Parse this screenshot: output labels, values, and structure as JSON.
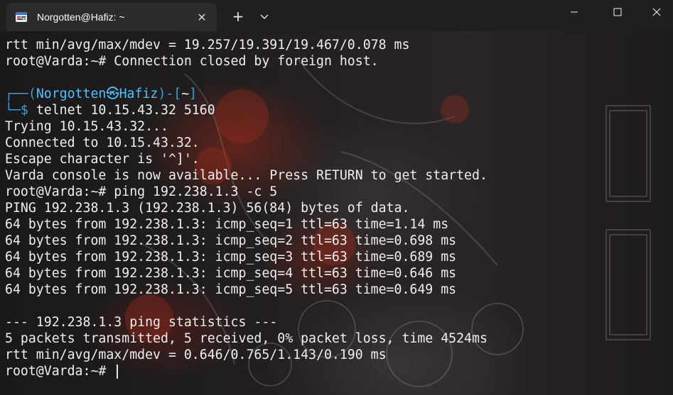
{
  "window": {
    "tab_title": "Norgotten@Hafiz: ~",
    "new_tab_symbol": "+",
    "tab_close_symbol": "✕"
  },
  "terminal": {
    "lines": [
      {
        "text": "rtt min/avg/max/mdev = 19.257/19.391/19.467/0.078 ms"
      },
      {
        "text": "root@Varda:~# Connection closed by foreign host."
      },
      {
        "text": ""
      },
      {
        "prompt": {
          "top_left": "┌──(",
          "user": "Norgotten",
          "separator": "㉿",
          "host": "Hafiz",
          "mid": ")-[",
          "dir": "~",
          "end": "]"
        }
      },
      {
        "prompt2": {
          "prefix": "└─$ ",
          "command": "telnet 10.15.43.32 5160"
        }
      },
      {
        "text": "Trying 10.15.43.32..."
      },
      {
        "text": "Connected to 10.15.43.32."
      },
      {
        "text": "Escape character is '^]'."
      },
      {
        "text": "Varda console is now available... Press RETURN to get started."
      },
      {
        "text": "root@Varda:~# ping 192.238.1.3 -c 5"
      },
      {
        "text": "PING 192.238.1.3 (192.238.1.3) 56(84) bytes of data."
      },
      {
        "text": "64 bytes from 192.238.1.3: icmp_seq=1 ttl=63 time=1.14 ms"
      },
      {
        "text": "64 bytes from 192.238.1.3: icmp_seq=2 ttl=63 time=0.698 ms"
      },
      {
        "text": "64 bytes from 192.238.1.3: icmp_seq=3 ttl=63 time=0.689 ms"
      },
      {
        "text": "64 bytes from 192.238.1.3: icmp_seq=4 ttl=63 time=0.646 ms"
      },
      {
        "text": "64 bytes from 192.238.1.3: icmp_seq=5 ttl=63 time=0.649 ms"
      },
      {
        "text": ""
      },
      {
        "text": "--- 192.238.1.3 ping statistics ---"
      },
      {
        "text": "5 packets transmitted, 5 received, 0% packet loss, time 4524ms"
      },
      {
        "text": "rtt min/avg/max/mdev = 0.646/0.765/1.143/0.190 ms"
      },
      {
        "text": "root@Varda:~# "
      }
    ]
  },
  "colors": {
    "titlebar_bg": "#1f1f1f",
    "tab_bg": "#2d2a2b",
    "terminal_text": "#efefef",
    "prompt_frame": "#3b9fd3",
    "prompt_user_host": "#4fc1ff"
  },
  "icons": {
    "tab_icon": "kali-terminal-icon",
    "dropdown": "chevron-down-icon",
    "minimize": "minimize-icon",
    "maximize": "maximize-icon",
    "close": "close-icon"
  }
}
